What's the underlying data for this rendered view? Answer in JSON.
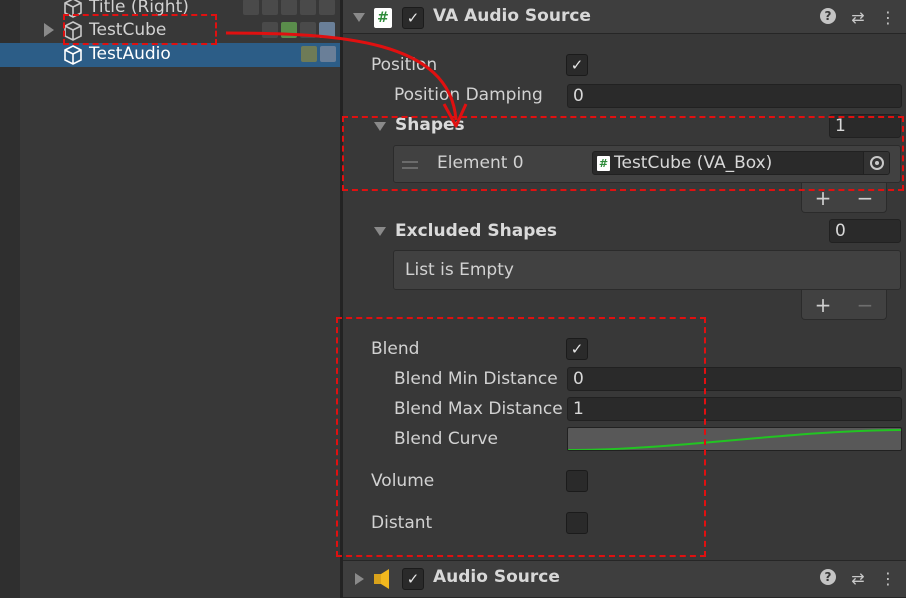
{
  "hierarchy": {
    "items": [
      {
        "label": "Title (Right)"
      },
      {
        "label": "TestCube"
      },
      {
        "label": "TestAudio"
      }
    ]
  },
  "inspector": {
    "va_component": {
      "title": "VA Audio Source",
      "enabled": true,
      "script_glyph": "#",
      "position_label": "Position",
      "position_checked": "✓",
      "position_damping_label": "Position Damping",
      "position_damping_value": "0",
      "shapes_label": "Shapes",
      "shapes_size": "1",
      "shapes_elements": [
        {
          "label": "Element 0",
          "value": "TestCube (VA_Box)"
        }
      ],
      "excluded_shapes_label": "Excluded Shapes",
      "excluded_shapes_size": "0",
      "excluded_empty_text": "List is Empty",
      "blend_label": "Blend",
      "blend_checked": "✓",
      "blend_min_label": "Blend Min Distance",
      "blend_min_value": "0",
      "blend_max_label": "Blend Max Distance",
      "blend_max_value": "1",
      "blend_curve_label": "Blend Curve",
      "volume_label": "Volume",
      "distant_label": "Distant"
    },
    "audio_component": {
      "title": "Audio Source",
      "enabled": true
    },
    "tools": {
      "help": "?",
      "settings": "⇄",
      "menu": "⋮"
    },
    "list_buttons": {
      "add": "+",
      "remove": "−"
    },
    "check_glyph": "✓"
  },
  "colors": {
    "background": "#383838",
    "selection": "#2c5d87",
    "annotation": "#e01010",
    "curve": "#22c422"
  }
}
